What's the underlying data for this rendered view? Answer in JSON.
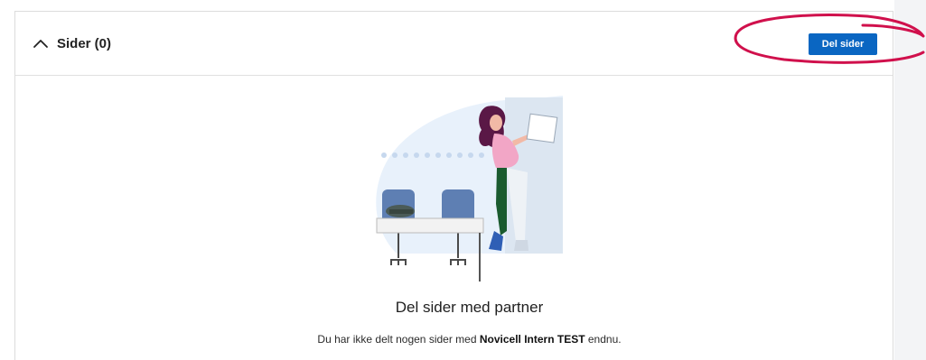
{
  "section": {
    "title": "Sider (0)",
    "toggle_icon": "chevron-up-icon",
    "share_button_label": "Del sider"
  },
  "empty_state": {
    "title": "Del sider med partner",
    "description_prefix": "Du har ikke delt nogen sider med ",
    "partner_name": "Novicell Intern TEST",
    "description_suffix": " endnu.",
    "illustration_icon": "person-at-standing-desk-illustration"
  },
  "colors": {
    "primary_button": "#0a66c2",
    "annotation_circle": "#d0104c",
    "rail_background": "#f3f4f6"
  }
}
